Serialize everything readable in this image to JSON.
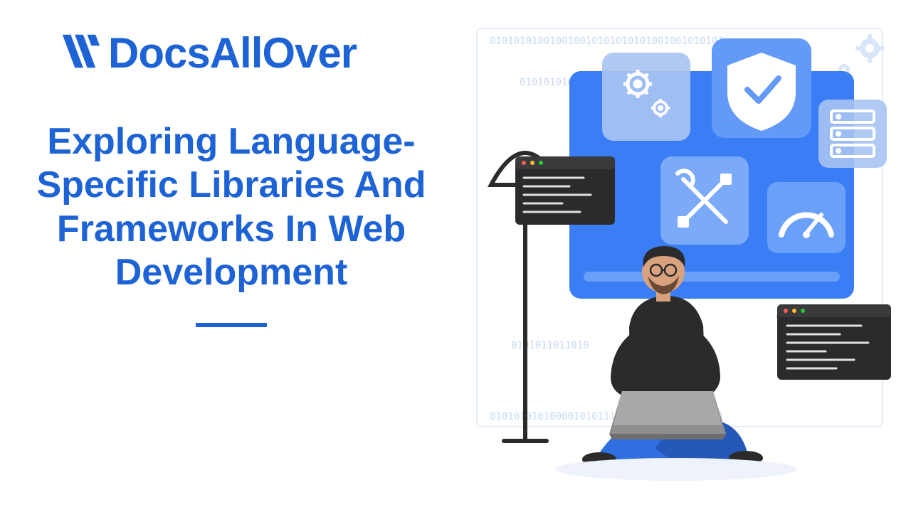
{
  "brand": {
    "name": "DocsAllOver",
    "accent": "#1e63d6"
  },
  "title": "Exploring Language-Specific Libraries And Frameworks In Web Development",
  "colors": {
    "primary": "#1e63d6",
    "illustration_blue": "#3a7df5",
    "illustration_light": "#a8c4f2",
    "illustration_dark": "#2b2b2b",
    "skin": "#d9a27e",
    "pants": "#2f6fe0",
    "laptop": "#8e8e8e"
  }
}
